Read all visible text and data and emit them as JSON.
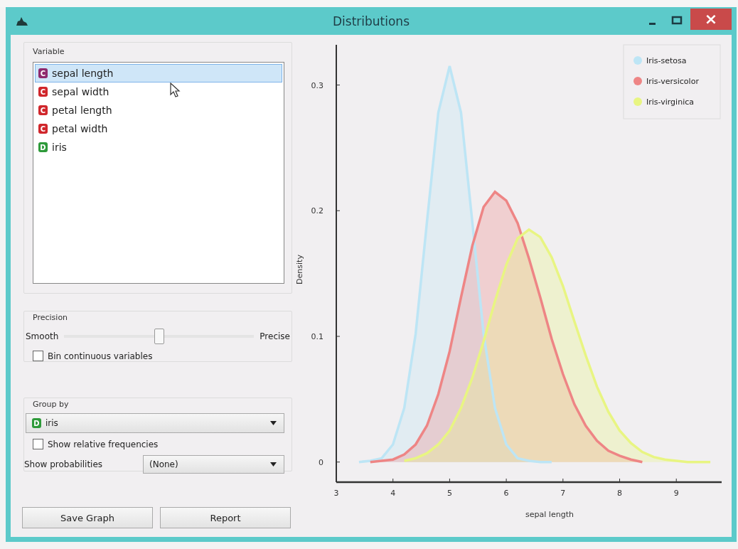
{
  "window": {
    "title": "Distributions",
    "close_glyph": "×"
  },
  "variable": {
    "title": "Variable",
    "items": [
      {
        "badge": "C",
        "color": "#8e2a6e",
        "label": "sepal length",
        "selected": true
      },
      {
        "badge": "C",
        "color": "#d0262b",
        "label": "sepal width",
        "selected": false
      },
      {
        "badge": "C",
        "color": "#d0262b",
        "label": "petal length",
        "selected": false
      },
      {
        "badge": "C",
        "color": "#d0262b",
        "label": "petal width",
        "selected": false
      },
      {
        "badge": "D",
        "color": "#2e9a3a",
        "label": "iris",
        "selected": false
      }
    ]
  },
  "precision": {
    "title": "Precision",
    "left_label": "Smooth",
    "right_label": "Precise",
    "level": 0.5,
    "bin_checkbox": {
      "label": "Bin continuous variables",
      "checked": false
    }
  },
  "group_by": {
    "title": "Group by",
    "dropdown": {
      "badge": "D",
      "color": "#2e9a3a",
      "value": "iris"
    },
    "relative_checkbox": {
      "label": "Show relative frequencies",
      "checked": false
    },
    "probabilities_label": "Show probabilities",
    "probabilities_value": "(None)"
  },
  "buttons": [
    "Save Graph",
    "Report"
  ],
  "plot": {
    "chart_data": {
      "type": "area",
      "xlabel": "sepal length",
      "ylabel": "Density",
      "xlim": [
        3,
        9.8
      ],
      "ylim": [
        -0.016,
        0.332
      ],
      "xticks": [
        3,
        4,
        5,
        6,
        7,
        8,
        9
      ],
      "yticks": [
        0,
        0.1,
        0.2,
        0.3
      ],
      "legend": "upper right",
      "x": [
        3.4,
        3.6,
        3.8,
        4.0,
        4.2,
        4.4,
        4.6,
        4.8,
        5.0,
        5.2,
        5.4,
        5.6,
        5.8,
        6.0,
        6.2,
        6.4,
        6.6,
        6.8,
        7.0,
        7.2,
        7.4,
        7.6,
        7.8,
        8.0,
        8.2,
        8.4,
        8.6,
        8.8,
        9.0,
        9.2,
        9.4,
        9.6
      ],
      "series": [
        {
          "name": "Iris-setosa",
          "color": "#bde5f5",
          "values": [
            0,
            0.001,
            0.003,
            0.014,
            0.043,
            0.102,
            0.191,
            0.278,
            0.315,
            0.278,
            0.191,
            0.102,
            0.043,
            0.014,
            0.003,
            0.001,
            0,
            0,
            null,
            null,
            null,
            null,
            null,
            null,
            null,
            null,
            null,
            null,
            null,
            null,
            null,
            null
          ]
        },
        {
          "name": "Iris-versicolor",
          "color": "#ee8585",
          "values": [
            null,
            0,
            0.001,
            0.002,
            0.006,
            0.014,
            0.029,
            0.054,
            0.088,
            0.131,
            0.172,
            0.203,
            0.215,
            0.208,
            0.19,
            0.162,
            0.131,
            0.098,
            0.07,
            0.046,
            0.029,
            0.017,
            0.009,
            0.005,
            0.002,
            0,
            null,
            null,
            null,
            null,
            null,
            null
          ]
        },
        {
          "name": "Iris-virginica",
          "color": "#e8f582",
          "values": [
            null,
            null,
            null,
            null,
            0.001,
            0.003,
            0.007,
            0.014,
            0.025,
            0.043,
            0.067,
            0.096,
            0.128,
            0.157,
            0.178,
            0.185,
            0.179,
            0.163,
            0.14,
            0.112,
            0.085,
            0.06,
            0.04,
            0.025,
            0.015,
            0.008,
            0.004,
            0.002,
            0.001,
            0,
            0,
            0
          ]
        }
      ]
    }
  }
}
